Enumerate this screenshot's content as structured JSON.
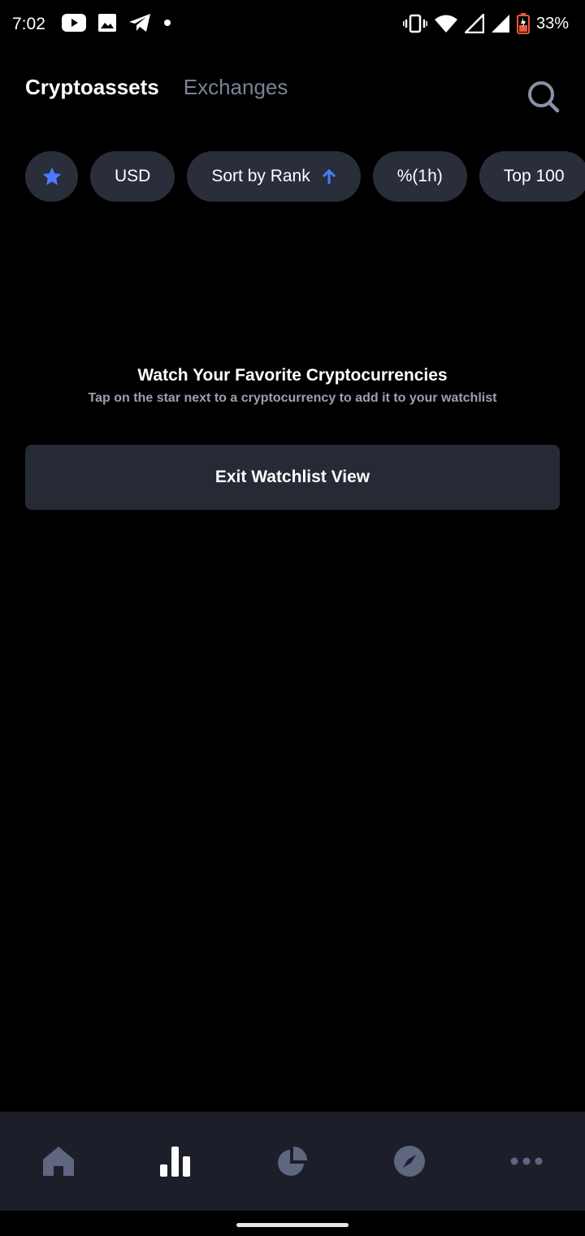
{
  "status_bar": {
    "time": "7:02",
    "battery_percent": "33%",
    "left_icons": [
      "youtube-icon",
      "gallery-icon",
      "telegram-icon",
      "dot-icon"
    ],
    "right_icons": [
      "vibrate-icon",
      "wifi-icon",
      "signal-icon",
      "signal-icon",
      "battery-icon"
    ]
  },
  "header": {
    "tabs": [
      {
        "label": "Cryptoassets",
        "active": true
      },
      {
        "label": "Exchanges",
        "active": false
      }
    ],
    "search_icon": "search-icon"
  },
  "filters": {
    "star_icon": "star-icon",
    "currency": "USD",
    "sort": "Sort by Rank",
    "sort_icon": "arrow-up-icon",
    "change": "%(1h)",
    "top": "Top 100"
  },
  "empty_state": {
    "title": "Watch Your Favorite Cryptocurrencies",
    "subtitle": "Tap on the star next to a cryptocurrency to add it to your watchlist",
    "button_label": "Exit Watchlist View"
  },
  "bottom_nav": {
    "items": [
      "home-icon",
      "chart-bars-icon",
      "pie-chart-icon",
      "compass-icon",
      "more-icon"
    ],
    "active_index": 1
  },
  "colors": {
    "background": "#000000",
    "pill": "#2a2e3b",
    "accent": "#4a7cff",
    "inactive_text": "#7a8296",
    "nav_bg": "#1c1f2a"
  }
}
